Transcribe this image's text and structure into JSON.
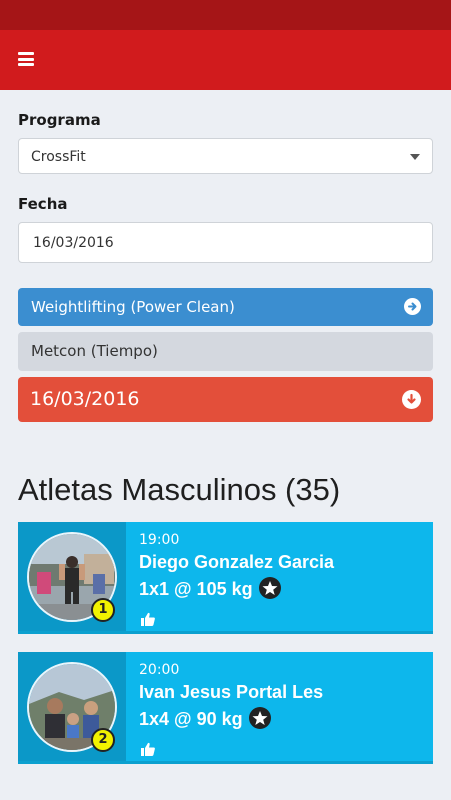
{
  "header": {
    "menu_icon": "hamburger-menu-icon"
  },
  "filters": {
    "program_label": "Programa",
    "program_value": "CrossFit",
    "date_label": "Fecha",
    "date_value": "16/03/2016"
  },
  "workouts": {
    "weightlifting_label": "Weightlifting (Power Clean)",
    "metcon_label": "Metcon (Tiempo)",
    "date_bar_label": "16/03/2016"
  },
  "athletes": {
    "title": "Atletas Masculinos (35)",
    "items": [
      {
        "rank": "1",
        "time": "19:00",
        "name": "Diego Gonzalez Garcia",
        "result": "1x1 @ 105 kg"
      },
      {
        "rank": "2",
        "time": "20:00",
        "name": "Ivan Jesus Portal Les",
        "result": "1x4 @ 90 kg"
      }
    ]
  },
  "colors": {
    "status_bar": "#a51517",
    "app_bar": "#d11b1d",
    "blue_bar": "#3b8ed0",
    "red_bar": "#e34f3a",
    "card": "#0db7ec",
    "badge": "#f2f200"
  }
}
